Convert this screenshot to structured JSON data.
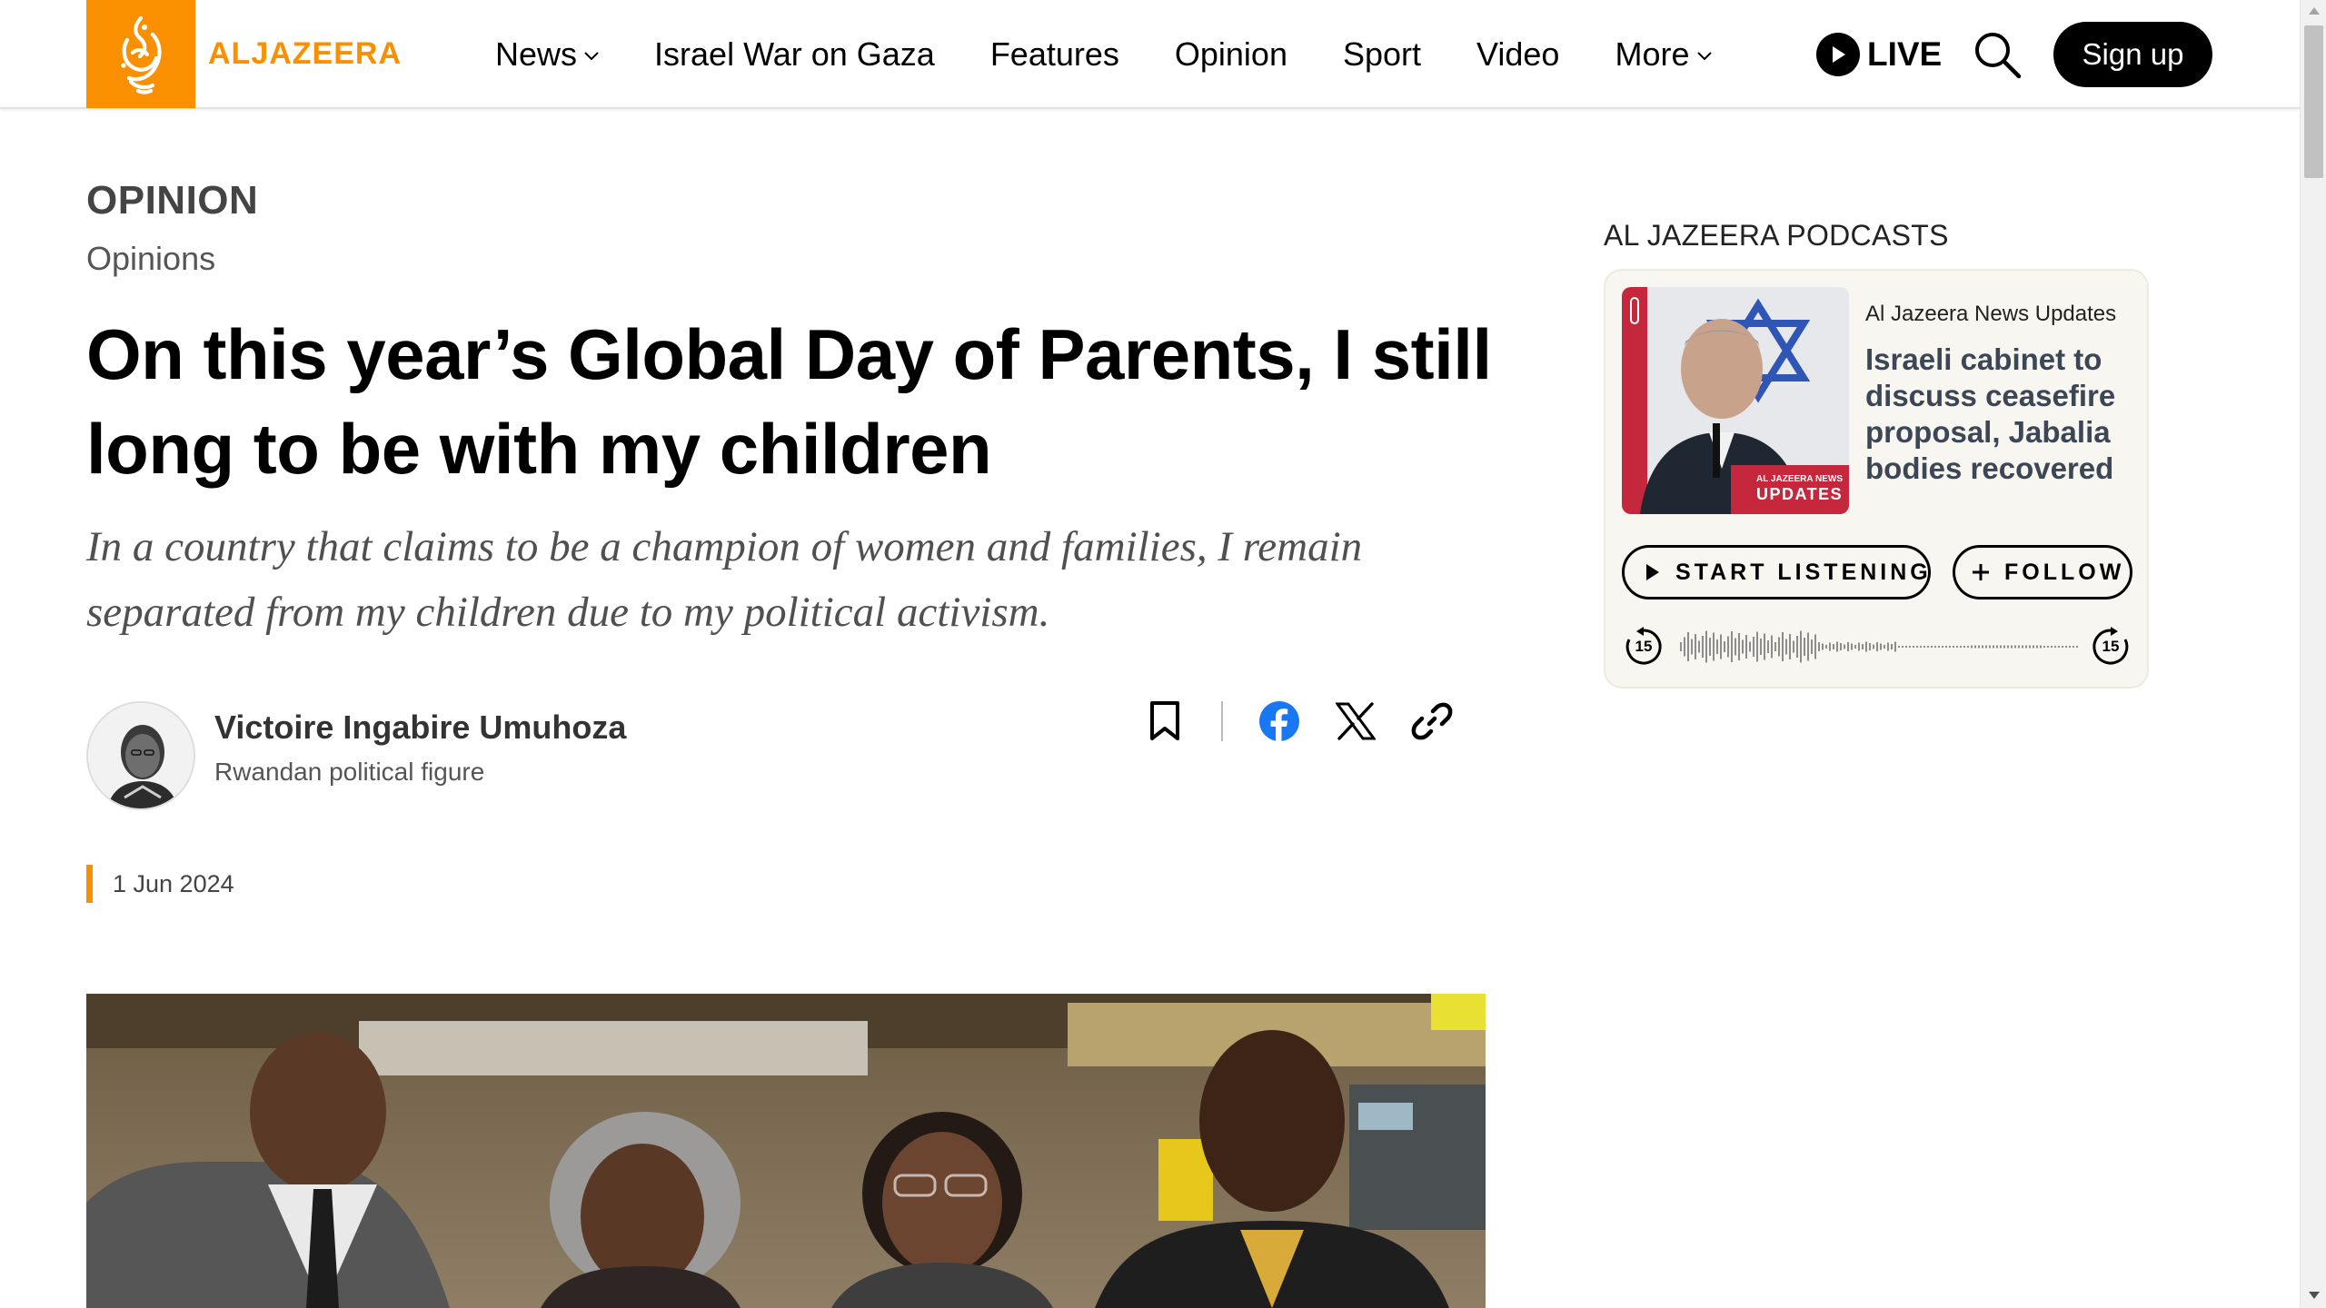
{
  "header": {
    "logo_text": "ALJAZEERA",
    "nav": [
      {
        "label": "News",
        "dropdown": true
      },
      {
        "label": "Israel War on Gaza",
        "dropdown": false
      },
      {
        "label": "Features",
        "dropdown": false
      },
      {
        "label": "Opinion",
        "dropdown": false
      },
      {
        "label": "Sport",
        "dropdown": false
      },
      {
        "label": "Video",
        "dropdown": false
      },
      {
        "label": "More",
        "dropdown": true
      }
    ],
    "live_label": "LIVE",
    "signup_label": "Sign up"
  },
  "article": {
    "section": "OPINION",
    "subsection": "Opinions",
    "headline": "On this year’s Global Day of Parents, I still long to be with my children",
    "dek": "In a country that claims to be a champion of women and families, I remain separated from my children due to my political activism.",
    "author": {
      "name": "Victoire Ingabire Umuhoza",
      "role": "Rwandan political figure"
    },
    "date": "1 Jun 2024",
    "share_icons": [
      "bookmark-icon",
      "facebook-icon",
      "x-icon",
      "link-icon"
    ]
  },
  "podcasts": {
    "heading": "AL JAZEERA PODCASTS",
    "show": "Al Jazeera News Updates",
    "episode_title": "Israeli cabinet to discuss ceasefire proposal, Jabalia bodies recovered",
    "thumb_badge_small": "AL JAZEERA NEWS",
    "thumb_badge_large": "UPDATES",
    "listen_label": "START LISTENING",
    "follow_label": "FOLLOW",
    "skip_back_label": "15",
    "skip_fwd_label": "15"
  },
  "colors": {
    "brand": "#fa9000",
    "podcast_card_bg": "#f8f6f1",
    "podcast_title": "#3c4654"
  }
}
